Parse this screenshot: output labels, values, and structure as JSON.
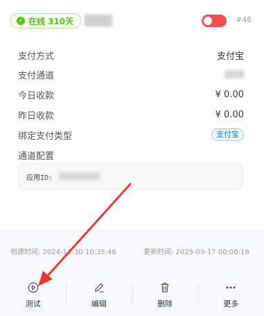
{
  "header": {
    "status_icon": "check-circle-icon",
    "status_text": "在线 310天",
    "card_id": "#46",
    "toggle_color": "#ff4d4f",
    "status_color": "#52c41a"
  },
  "fields": [
    {
      "label": "支付方式",
      "value": "支付宝"
    },
    {
      "label": "支付通道",
      "value": ""
    },
    {
      "label": "今日收款",
      "value": "¥ 0.00"
    },
    {
      "label": "昨日收款",
      "value": "¥ 0.00"
    },
    {
      "label": "绑定支付类型",
      "value": "支付宝"
    }
  ],
  "config": {
    "label": "通道配置",
    "app_id_label": "应用ID:"
  },
  "times": {
    "created": "创建时间: 2024-11-30 10:35:46",
    "updated": "更新时间: 2025-09-17 00:00:18"
  },
  "actions": [
    {
      "label": "测试",
      "icon": "play-circle-icon"
    },
    {
      "label": "编辑",
      "icon": "edit-icon"
    },
    {
      "label": "删除",
      "icon": "trash-icon"
    },
    {
      "label": "更多",
      "icon": "more-icon"
    }
  ],
  "annotation_color": "#e53935"
}
